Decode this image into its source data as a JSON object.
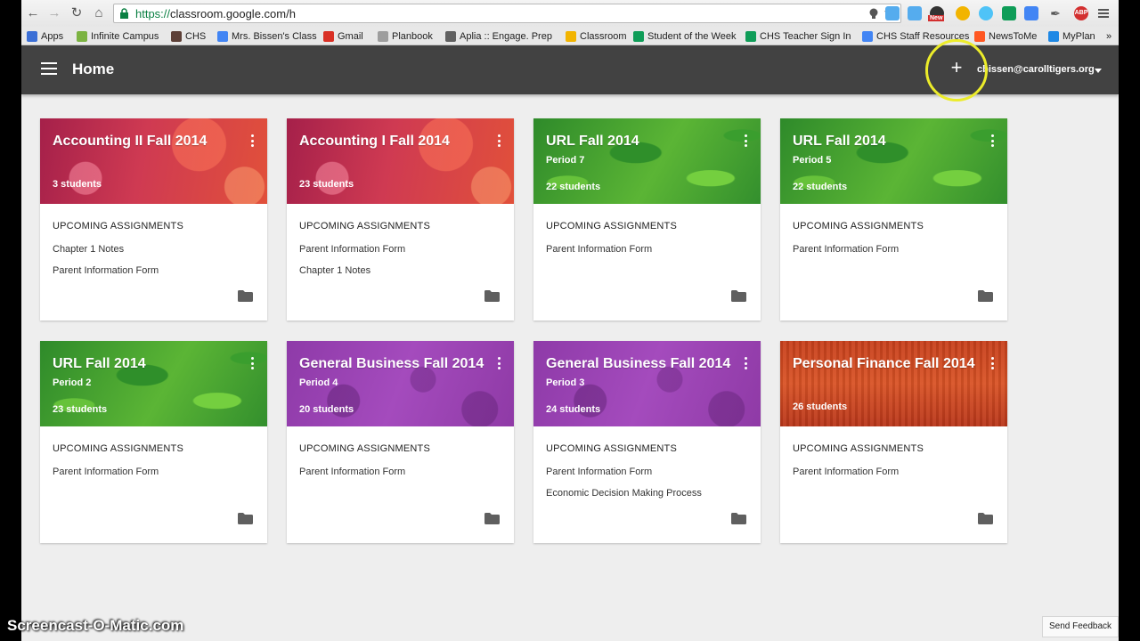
{
  "browser": {
    "url_proto": "https://",
    "url_rest": "classroom.google.com/h",
    "extension_badge": "New",
    "extension_abp": "ABP"
  },
  "bookmarks": [
    {
      "label": "Apps",
      "color": "#3b6fd6"
    },
    {
      "label": "Infinite Campus",
      "color": "#7cb342"
    },
    {
      "label": "CHS",
      "color": "#5d4037"
    },
    {
      "label": "Mrs. Bissen's Class",
      "color": "#4285f4"
    },
    {
      "label": "Gmail",
      "color": "#d93025"
    },
    {
      "label": "Planbook",
      "color": "#9e9e9e"
    },
    {
      "label": "Aplia :: Engage. Prep",
      "color": "#616161"
    },
    {
      "label": "Classroom",
      "color": "#f2b400"
    },
    {
      "label": "Student of the Week",
      "color": "#0f9d58"
    },
    {
      "label": "CHS Teacher Sign In",
      "color": "#0f9d58"
    },
    {
      "label": "CHS Staff Resources",
      "color": "#4285f4"
    },
    {
      "label": "NewsToMe",
      "color": "#ff5722"
    },
    {
      "label": "MyPlan",
      "color": "#1e88e5"
    }
  ],
  "bookmarks_overflow": "»",
  "app": {
    "title": "Home",
    "add_symbol": "+",
    "account": "cbissen@carolltigers.org"
  },
  "classes": [
    {
      "title": "Accounting II Fall 2014",
      "period": "",
      "students": "3 students",
      "theme": "red",
      "assignments": [
        "Chapter 1 Notes",
        "Parent Information Form"
      ]
    },
    {
      "title": "Accounting I Fall 2014",
      "period": "",
      "students": "23 students",
      "theme": "red",
      "assignments": [
        "Parent Information Form",
        "Chapter 1 Notes"
      ]
    },
    {
      "title": "URL Fall 2014",
      "period": "Period 7",
      "students": "22 students",
      "theme": "green",
      "assignments": [
        "Parent Information Form"
      ]
    },
    {
      "title": "URL Fall 2014",
      "period": "Period 5",
      "students": "22 students",
      "theme": "green",
      "assignments": [
        "Parent Information Form"
      ]
    },
    {
      "title": "URL Fall 2014",
      "period": "Period 2",
      "students": "23 students",
      "theme": "green",
      "assignments": [
        "Parent Information Form"
      ]
    },
    {
      "title": "General Business Fall 2014",
      "period": "Period 4",
      "students": "20 students",
      "theme": "purple",
      "assignments": [
        "Parent Information Form"
      ]
    },
    {
      "title": "General Business Fall 2014",
      "period": "Period 3",
      "students": "24 students",
      "theme": "purple",
      "assignments": [
        "Parent Information Form",
        "Economic Decision Making Process"
      ]
    },
    {
      "title": "Personal Finance Fall 2014",
      "period": "",
      "students": "26 students",
      "theme": "orange",
      "assignments": [
        "Parent Information Form"
      ]
    }
  ],
  "upcoming_label": "UPCOMING ASSIGNMENTS",
  "feedback": "Send Feedback",
  "watermark": "Screencast-O-Matic.com"
}
